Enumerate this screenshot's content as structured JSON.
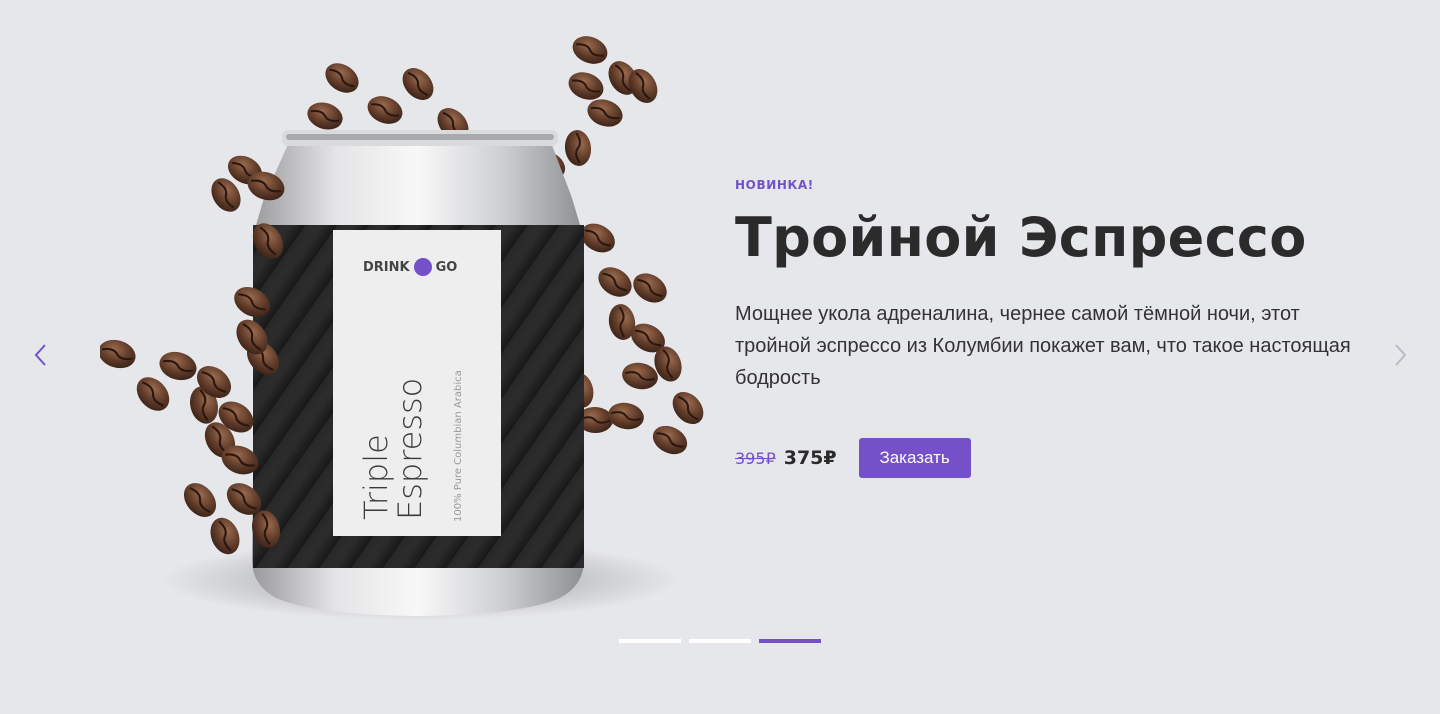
{
  "slider": {
    "prev_icon": "chevron-left-icon",
    "next_icon": "chevron-right-icon",
    "pagination_count": 3,
    "active_slide": 3
  },
  "product": {
    "brand_left": "DRINK",
    "brand_right": "GO",
    "can_title_line1": "Triple",
    "can_title_line2": "Espresso",
    "can_subtitle": "100% Pure Columbian Arabica"
  },
  "slide": {
    "badge": "НОВИНКА!",
    "title": "Тройной Эспрессо",
    "description": "Мощнее укола адреналина, чернее самой тёмной ночи, этот тройной эспрессо из Колумбии покажет вам, что такое настоящая бодрость",
    "old_price": "395₽",
    "new_price": "375₽",
    "order_button": "Заказать"
  },
  "colors": {
    "background": "#e6e7ea",
    "accent": "#7551c9",
    "text": "#2b2b2b"
  }
}
